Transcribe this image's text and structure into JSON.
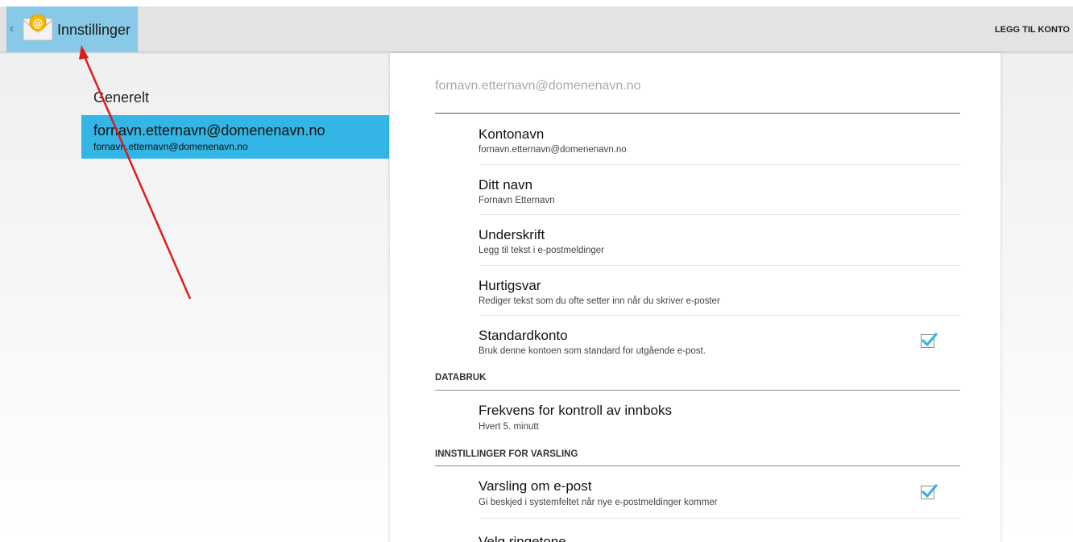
{
  "action_bar": {
    "up_caret": "‹",
    "title": "Innstillinger",
    "add_account_label": "LEGG TIL KONTO",
    "app_icon": "email-app-icon"
  },
  "left_pane": {
    "general_label": "Generelt",
    "account": {
      "title": "fornavn.etternavn@domenenavn.no",
      "subtitle": "fornavn.etternavn@domenenavn.no"
    }
  },
  "right_pane": {
    "header": "fornavn.etternavn@domenenavn.no",
    "items": [
      {
        "title": "Kontonavn",
        "summary": "fornavn.etternavn@domenenavn.no"
      },
      {
        "title": "Ditt navn",
        "summary": "Fornavn Etternavn"
      },
      {
        "title": "Underskrift",
        "summary": "Legg til tekst i e-postmeldinger"
      },
      {
        "title": "Hurtigsvar",
        "summary": "Rediger tekst som du ofte setter inn når du skriver e-poster"
      },
      {
        "title": "Standardkonto",
        "summary": "Bruk denne kontoen som standard for utgående e-post.",
        "checked": true
      }
    ],
    "data_category": {
      "label": "DATABRUK",
      "items": [
        {
          "title": "Frekvens for kontroll av innboks",
          "summary": "Hvert 5. minutt"
        }
      ]
    },
    "notify_category": {
      "label": "INNSTILLINGER FOR VARSLING",
      "items": [
        {
          "title": "Varsling om e-post",
          "summary": "Gi beskjed i systemfeltet når nye e-postmeldinger kommer",
          "checked": true
        },
        {
          "title": "Velg ringetone",
          "summary": ""
        }
      ]
    }
  },
  "colors": {
    "accent": "#33b5e5",
    "up_button_bg": "#87c9e6",
    "annotation_arrow": "#e01b1b",
    "checkbox_check": "#33b5e5"
  }
}
